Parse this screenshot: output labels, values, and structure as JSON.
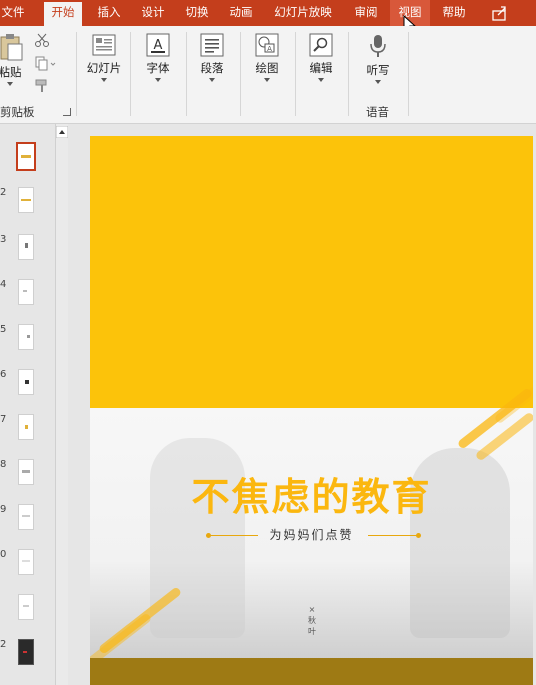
{
  "tabs": [
    {
      "label": "文件"
    },
    {
      "label": "开始"
    },
    {
      "label": "插入"
    },
    {
      "label": "设计"
    },
    {
      "label": "切换"
    },
    {
      "label": "动画"
    },
    {
      "label": "幻灯片放映"
    },
    {
      "label": "审阅"
    },
    {
      "label": "视图"
    },
    {
      "label": "帮助"
    }
  ],
  "ribbon": {
    "paste_label": "粘贴",
    "clipboard_group": "剪贴板",
    "slides_label": "幻灯片",
    "font_label": "字体",
    "paragraph_label": "段落",
    "drawing_label": "绘图",
    "editing_label": "编辑",
    "dictate_label": "听写",
    "voice_group": "语音"
  },
  "thumbnails": {
    "numbers": [
      "",
      "2",
      "3",
      "4",
      "5",
      "6",
      "7",
      "8",
      "9",
      "0",
      "",
      "2"
    ]
  },
  "slide": {
    "title": "不焦虑的教育",
    "subtitle": "为妈妈们点赞",
    "credit_symbol": "×",
    "credit_name_1": "秋",
    "credit_name_2": "叶"
  },
  "colors": {
    "tab_bar": "#c43e1c",
    "slide_yellow": "#fcc30a",
    "title_yellow": "#fbb70f",
    "bottom_band": "#9e7a14"
  }
}
